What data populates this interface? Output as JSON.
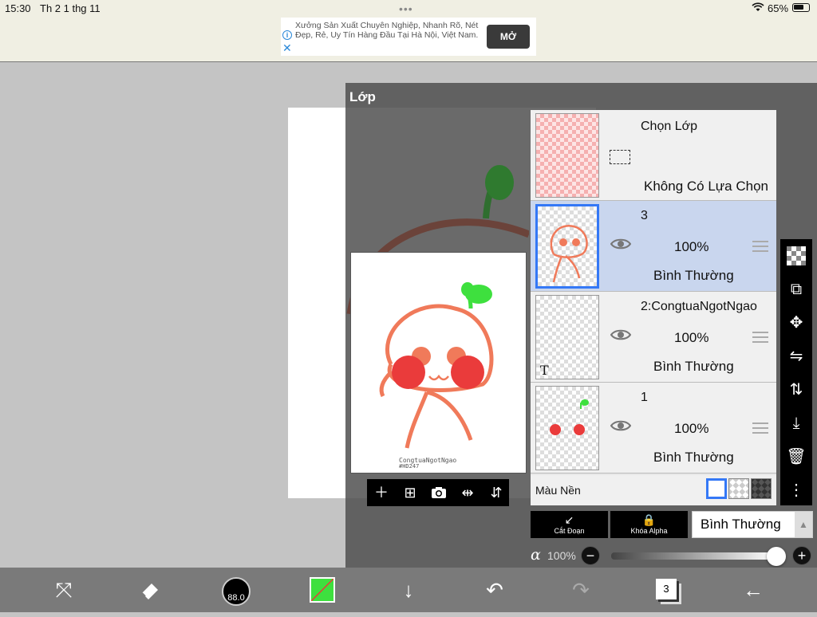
{
  "status_bar": {
    "time": "15:30",
    "date": "Th 2 1 thg 11",
    "battery": "65%"
  },
  "ad": {
    "text": "Xưởng Sản Xuất Chuyên Nghiệp, Nhanh Rõ, Nét Đẹp, Rẻ, Uy Tín Hàng Đầu Tại Hà Nội, Việt Nam.",
    "button": "MỞ"
  },
  "panel": {
    "title": "Lớp"
  },
  "preview": {
    "watermark_line1": "CongtuaNgotNgao",
    "watermark_line2": "#HD247"
  },
  "selection_layer": {
    "title": "Chọn Lớp",
    "status": "Không Có Lựa Chọn"
  },
  "layers": [
    {
      "name": "3",
      "opacity": "100%",
      "mode": "Bình Thường",
      "selected": true
    },
    {
      "name": "2:CongtuaNgotNgao",
      "opacity": "100%",
      "mode": "Bình Thường",
      "selected": false
    },
    {
      "name": "1",
      "opacity": "100%",
      "mode": "Bình Thường",
      "selected": false
    }
  ],
  "background_row": {
    "label": "Màu Nền"
  },
  "bottom_buttons": {
    "clipping": "Cắt Đoạn",
    "alpha_lock": "Khóa Alpha",
    "blend_mode": "Bình Thường"
  },
  "alpha": {
    "symbol": "α",
    "value": "100%"
  },
  "toolbar": {
    "brush_size": "88.0",
    "layer_count": "3",
    "color": "#3ee03e"
  },
  "colors": {
    "accent": "#3478f6",
    "selected_layer": "#c9d6ee"
  }
}
